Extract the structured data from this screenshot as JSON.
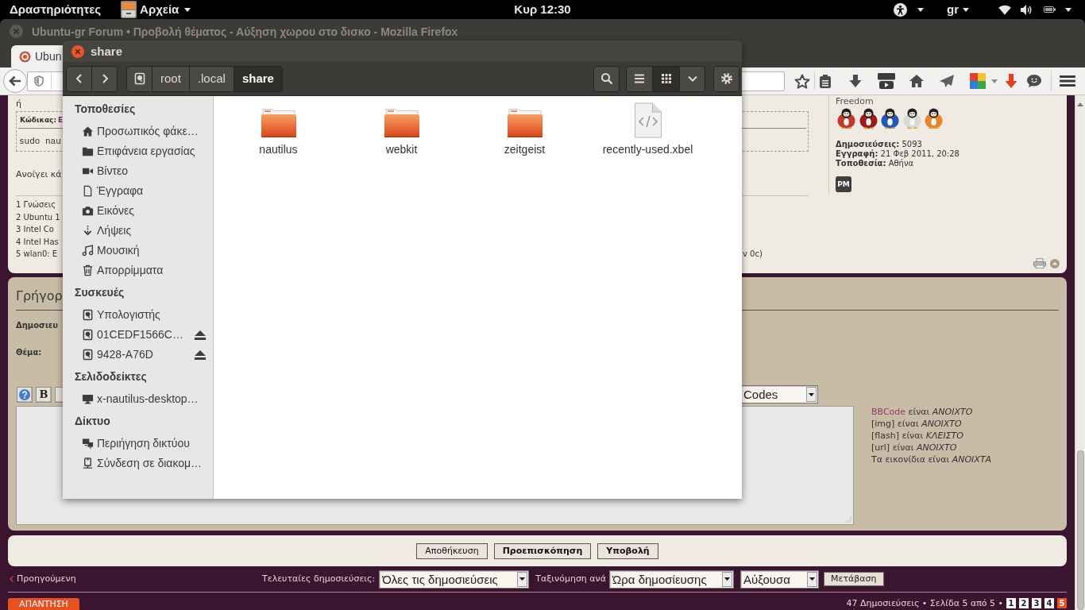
{
  "top_bar": {
    "activities": "Δραστηριότητες",
    "app_menu": "Αρχεία",
    "clock": "Κυρ 12:30",
    "keyboard_layout": "gr"
  },
  "browser": {
    "title": "Ubuntu-gr Forum • Προβολή θέματος - Αύξηση χωρου στο δισκο - Mozilla Firefox",
    "tab": {
      "title": "Ubun"
    }
  },
  "post": {
    "line_top": "ή",
    "code": {
      "label": "Κώδικας:",
      "link": "Ε",
      "text": "sudo nau"
    },
    "text": "Ανοίγει κά",
    "signature": [
      {
        "start": "1 Γνώσεις"
      },
      {
        "start": "2 Ubuntu 1"
      },
      {
        "start": "3 Intel Co"
      },
      {
        "start": "4 Intel Has"
      },
      {
        "start": "5 wlan0: E",
        "end": "v 0c)"
      }
    ],
    "profile": {
      "rank": "Freedom",
      "rank_images": [
        {
          "color": "#c0392b"
        },
        {
          "color": "#9b1c1c"
        },
        {
          "color": "#2456b4"
        },
        {
          "color": "#d8d8d8"
        },
        {
          "color": "#e8842c"
        }
      ],
      "fields": [
        {
          "label": "Δημοσιεύσεις:",
          "value": "5093"
        },
        {
          "label": "Εγγραφή:",
          "value": "21 Φεβ 2011, 20:28"
        },
        {
          "label": "Τοποθεσία:",
          "value": "Αθήνα"
        }
      ],
      "pm_button": "PM"
    }
  },
  "quick_reply": {
    "title": "Γρήγορ",
    "author_label": "Δημοσιευ",
    "subject_label": "Θέμα:",
    "format_buttons": [
      {
        "kind": "help"
      },
      {
        "kind": "bold",
        "label": "B"
      },
      {
        "kind": "plain"
      }
    ],
    "font_select": "Codes",
    "status": [
      {
        "link": "BBCode",
        "text": "είναι *ΑΝΟΙΧΤΟ*"
      },
      {
        "text": "[img] είναι *ΑΝΟΙΧΤΟ*"
      },
      {
        "text": "[flash] είναι *ΚΛΕΙΣΤΟ*"
      },
      {
        "text": "[url] είναι *ΑΝΟΙΧΤΟ*"
      },
      {
        "text": "Τα εικονίδια είναι *ΑΝΟΙΧΤΑ*"
      }
    ]
  },
  "form_buttons": [
    {
      "label": "Αποθήκευση",
      "kind": "normal"
    },
    {
      "label": "Προεπισκόπηση",
      "kind": "bold"
    },
    {
      "label": "Υποβολή",
      "kind": "bold"
    }
  ],
  "topic_nav": {
    "previous": "Προηγούμενη",
    "show_label": "Τελευταίες δημοσιεύσεις:",
    "show_select": "Όλες τις δημοσιεύσεις",
    "sort_label": "Ταξινόμηση ανά",
    "sort_select": "Ώρα δημοσίευσης",
    "order_select": "Αύξουσα",
    "go_button": "Μετάβαση"
  },
  "footer": {
    "reply_button": "ΑΠΑΝΤΗΣΗ",
    "summary": "47 Δημοσιεύσεις • Σελίδα 5 από 5 •",
    "pages": [
      {
        "label": "1",
        "selected": false
      },
      {
        "label": "2",
        "selected": false
      },
      {
        "label": "3",
        "selected": false
      },
      {
        "label": "4",
        "selected": false
      },
      {
        "label": "5",
        "selected": true
      }
    ]
  },
  "file_manager": {
    "title": "share",
    "path": [
      {
        "kind": "drive",
        "selected": false
      },
      {
        "kind": "folder",
        "label": "root",
        "selected": false
      },
      {
        "kind": "folder",
        "label": ".local",
        "selected": false
      },
      {
        "kind": "folder",
        "label": "share",
        "selected": true
      }
    ],
    "views": [
      {
        "kind": "list",
        "selected": false
      },
      {
        "kind": "grid",
        "selected": true
      }
    ],
    "sidebar": [
      {
        "heading": "Τοποθεσίες",
        "items": [
          {
            "label": "Προσωπικός φάκε…",
            "kind": "home"
          },
          {
            "label": "Επιφάνεια εργασίας",
            "kind": "desktop"
          },
          {
            "label": "Βίντεο",
            "kind": "videos"
          },
          {
            "label": "Έγγραφα",
            "kind": "documents"
          },
          {
            "label": "Εικόνες",
            "kind": "pictures"
          },
          {
            "label": "Λήψεις",
            "kind": "downloads"
          },
          {
            "label": "Μουσική",
            "kind": "music"
          },
          {
            "label": "Απορρίμματα",
            "kind": "trash"
          }
        ]
      },
      {
        "heading": "Συσκευές",
        "items": [
          {
            "label": "Υπολογιστής",
            "kind": "drive",
            "ejectable": false
          },
          {
            "label": "01CEDF1566C…",
            "kind": "drive",
            "ejectable": true
          },
          {
            "label": "9428-A76D",
            "kind": "drive",
            "ejectable": true
          }
        ]
      },
      {
        "heading": "Σελιδοδείκτες",
        "items": [
          {
            "label": "x-nautilus-desktop…",
            "kind": "bookmark"
          }
        ]
      },
      {
        "heading": "Δίκτυο",
        "items": [
          {
            "label": "Περιήγηση δικτύου",
            "kind": "network"
          },
          {
            "label": "Σύνδεση σε διακομ…",
            "kind": "server"
          }
        ]
      }
    ],
    "files": [
      {
        "name": "nautilus",
        "kind": "folder"
      },
      {
        "name": "webkit",
        "kind": "folder"
      },
      {
        "name": "zeitgeist",
        "kind": "folder"
      },
      {
        "name": "recently-used.xbel",
        "kind": "file"
      }
    ]
  }
}
